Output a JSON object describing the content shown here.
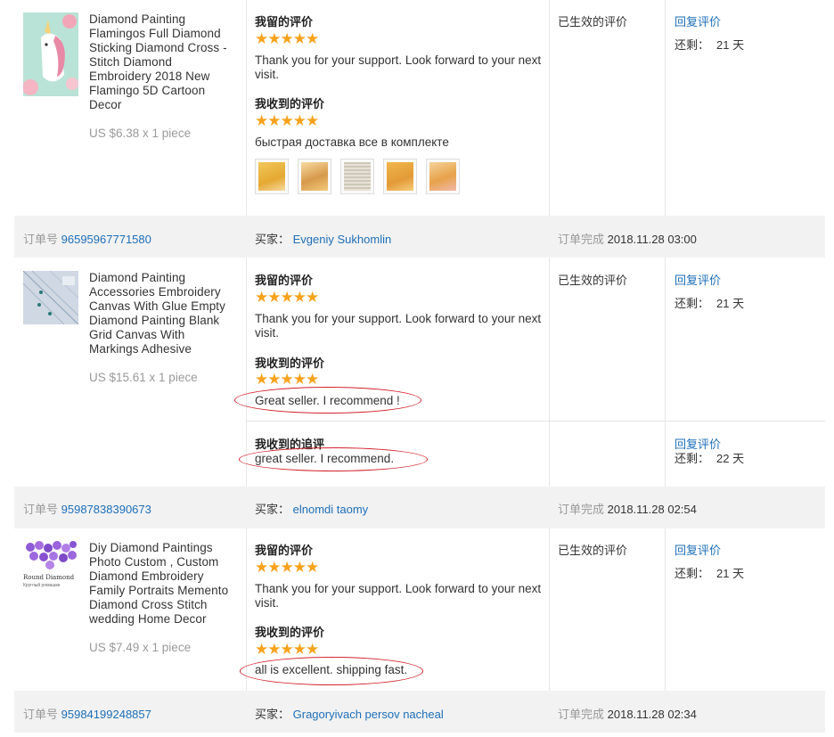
{
  "orders": [
    {
      "product": {
        "title": "Diamond Painting Flamingos Full Diamond Sticking Diamond Cross - Stitch Diamond Embroidery 2018 New Flamingo 5D Cartoon Decor",
        "price": "US $6.38 x 1 piece",
        "image": "unicorn-flamingo-painting"
      },
      "my_review": {
        "heading": "我留的评价",
        "stars": 5,
        "text": "Thank you for your support. Look forward to your next visit."
      },
      "received_review": {
        "heading": "我收到的评价",
        "stars": 5,
        "text": "быстрая доставка все в комплекте",
        "photo_count": 5
      },
      "status": "已生效的评价",
      "reply_link": "回复评价",
      "remaining_label": "还剩：",
      "remaining_value": "21 天"
    },
    {
      "bar": {
        "order_label": "订单号",
        "order_no": "96595967771580",
        "buyer_label": "买家：",
        "buyer": "Evgeniy Sukhomlin",
        "done_label": "订单完成",
        "done_time": "2018.11.28 03:00"
      },
      "product": {
        "title": "Diamond Painting Accessories Embroidery Canvas With Glue Empty Diamond Painting Blank Grid Canvas With Markings Adhesive",
        "price": "US $15.61 x 1 piece",
        "image": "blank-grid-canvas"
      },
      "my_review": {
        "heading": "我留的评价",
        "stars": 5,
        "text": "Thank you for your support. Look forward to your next visit."
      },
      "received_review": {
        "heading": "我收到的评价",
        "stars": 5,
        "text": "Great seller. I recommend !"
      },
      "status": "已生效的评价",
      "reply_link": "回复评价",
      "remaining_label": "还剩：",
      "remaining_value": "21 天",
      "followup": {
        "heading": "我收到的追评",
        "text": "great seller. I recommend.",
        "reply_link": "回复评价",
        "remaining_label": "还剩：",
        "remaining_value": "22 天"
      }
    },
    {
      "bar": {
        "order_label": "订单号",
        "order_no": "95987838390673",
        "buyer_label": "买家：",
        "buyer": "elnomdi taomy",
        "done_label": "订单完成",
        "done_time": "2018.11.28 02:54"
      },
      "product": {
        "title": "Diy Diamond Paintings Photo Custom , Custom Diamond Embroidery Family Portraits Memento Diamond Cross Stitch wedding Home Decor",
        "price": "US $7.49 x 1 piece",
        "image": "round-diamond-purple",
        "image_caption": "Round Diamond",
        "image_subcaption": "Круглый ромашки"
      },
      "my_review": {
        "heading": "我留的评价",
        "stars": 5,
        "text": "Thank you for your support. Look forward to your next visit."
      },
      "received_review": {
        "heading": "我收到的评价",
        "stars": 5,
        "text": "all is excellent. shipping fast."
      },
      "status": "已生效的评价",
      "reply_link": "回复评价",
      "remaining_label": "还剩：",
      "remaining_value": "21 天"
    },
    {
      "bar": {
        "order_label": "订单号",
        "order_no": "95984199248857",
        "buyer_label": "买家：",
        "buyer": "Gragoryivach persov nacheal",
        "done_label": "订单完成",
        "done_time": "2018.11.28 02:34"
      }
    }
  ],
  "star_glyphs": "★★★★★",
  "colors": {
    "link": "#1e6fb8",
    "star": "#f6a21d",
    "annotation": "#d2232a",
    "bar": "#f2f2f2"
  }
}
